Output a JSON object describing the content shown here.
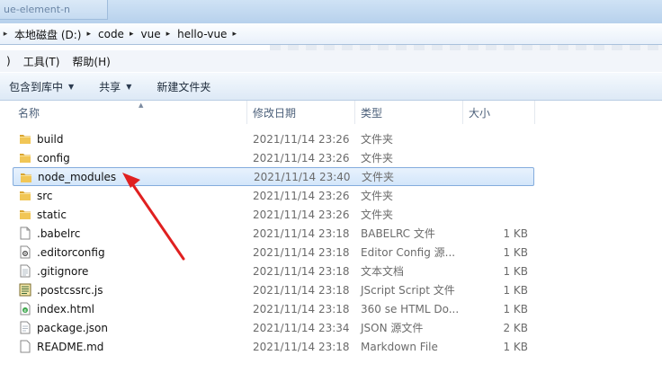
{
  "topbar": {
    "ghost_tab": "ue-element-n"
  },
  "address": {
    "crumbs": [
      "本地磁盘 (D:)",
      "code",
      "vue",
      "hello-vue"
    ]
  },
  "menu": {
    "items": [
      ")",
      "工具(T)",
      "帮助(H)"
    ]
  },
  "toolbar": {
    "include_label": "包含到库中",
    "share_label": "共享",
    "new_folder_label": "新建文件夹"
  },
  "columns": {
    "name": "名称",
    "modified": "修改日期",
    "type": "类型",
    "size": "大小"
  },
  "files": [
    {
      "name": "build",
      "date": "2021/11/14 23:26",
      "type": "文件夹",
      "size": "",
      "icon": "folder-icon"
    },
    {
      "name": "config",
      "date": "2021/11/14 23:26",
      "type": "文件夹",
      "size": "",
      "icon": "folder-icon"
    },
    {
      "name": "node_modules",
      "date": "2021/11/14 23:40",
      "type": "文件夹",
      "size": "",
      "icon": "folder-icon",
      "selected": true
    },
    {
      "name": "src",
      "date": "2021/11/14 23:26",
      "type": "文件夹",
      "size": "",
      "icon": "folder-icon"
    },
    {
      "name": "static",
      "date": "2021/11/14 23:26",
      "type": "文件夹",
      "size": "",
      "icon": "folder-icon"
    },
    {
      "name": ".babelrc",
      "date": "2021/11/14 23:18",
      "type": "BABELRC 文件",
      "size": "1 KB",
      "icon": "blank-file-icon"
    },
    {
      "name": ".editorconfig",
      "date": "2021/11/14 23:18",
      "type": "Editor Config 源...",
      "size": "1 KB",
      "icon": "config-file-icon"
    },
    {
      "name": ".gitignore",
      "date": "2021/11/14 23:18",
      "type": "文本文档",
      "size": "1 KB",
      "icon": "text-file-icon"
    },
    {
      "name": ".postcssrc.js",
      "date": "2021/11/14 23:18",
      "type": "JScript Script 文件",
      "size": "1 KB",
      "icon": "script-file-icon"
    },
    {
      "name": "index.html",
      "date": "2021/11/14 23:18",
      "type": "360 se HTML Do...",
      "size": "1 KB",
      "icon": "html-file-icon"
    },
    {
      "name": "package.json",
      "date": "2021/11/14 23:34",
      "type": "JSON 源文件",
      "size": "2 KB",
      "icon": "json-file-icon"
    },
    {
      "name": "README.md",
      "date": "2021/11/14 23:18",
      "type": "Markdown File",
      "size": "1 KB",
      "icon": "markdown-file-icon"
    }
  ],
  "colors": {
    "folder": "#e8b93f",
    "selection_border": "#84acdd",
    "annotation_arrow": "#e02020"
  }
}
